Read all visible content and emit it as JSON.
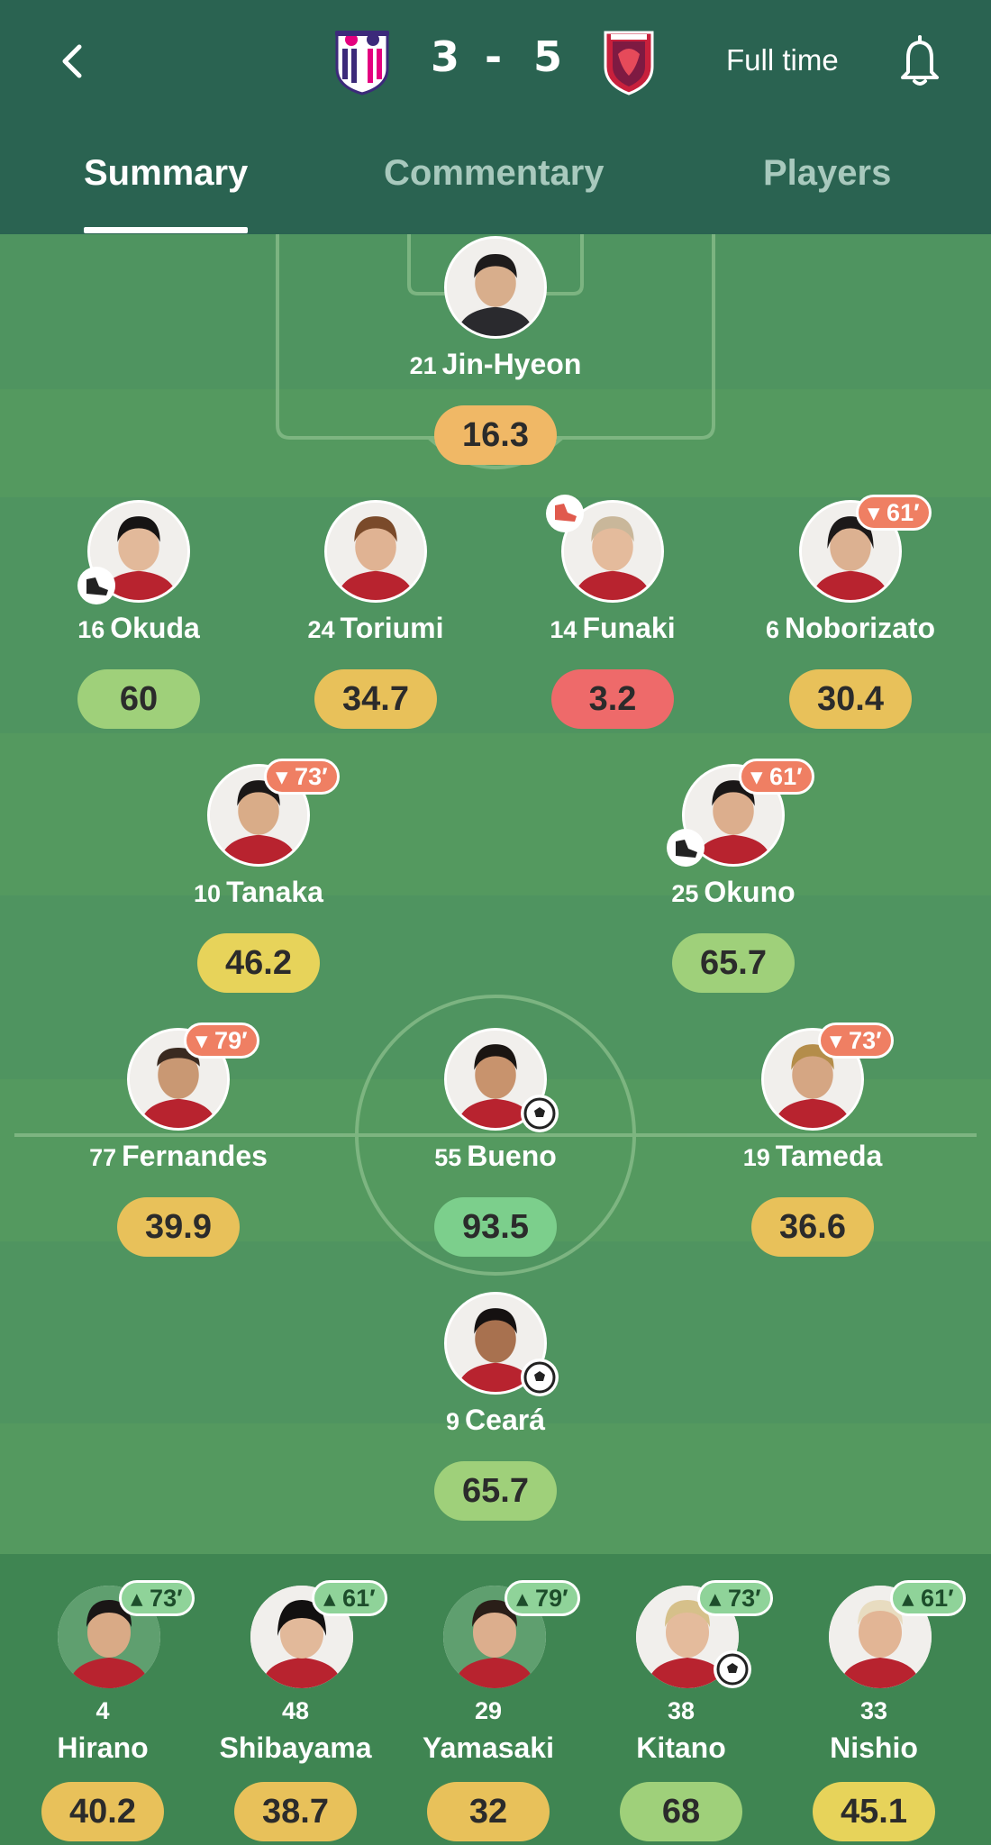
{
  "header": {
    "home_score": "3",
    "separator": "-",
    "away_score": "5",
    "status": "Full time",
    "tabs": [
      "Summary",
      "Commentary",
      "Players"
    ],
    "active_tab": "Summary"
  },
  "colors": {
    "header_bg": "#2a6351",
    "pitch": "#4f9460",
    "rating_green": "#9fd07a",
    "rating_dark_green": "#7ccf8c",
    "rating_yellow": "#e7d35a",
    "rating_amber": "#e8c15a",
    "rating_orange": "#f0b866",
    "rating_red": "#ee6a6a",
    "sub_out": "#ef7f63",
    "sub_in": "#8fd399"
  },
  "starters": [
    {
      "num": "21",
      "name": "Jin-Hyeon",
      "rating": "16.3",
      "rating_color": "#f0b866"
    },
    {
      "num": "16",
      "name": "Okuda",
      "rating": "60",
      "rating_color": "#9fd07a",
      "icon": "boot-icon"
    },
    {
      "num": "24",
      "name": "Toriumi",
      "rating": "34.7",
      "rating_color": "#e8c15a"
    },
    {
      "num": "14",
      "name": "Funaki",
      "rating": "3.2",
      "rating_color": "#ee6a6a",
      "icon": "red-boot-icon"
    },
    {
      "num": "6",
      "name": "Noborizato",
      "rating": "30.4",
      "rating_color": "#e8c15a",
      "sub": "▾ 61′"
    },
    {
      "num": "10",
      "name": "Tanaka",
      "rating": "46.2",
      "rating_color": "#e7d35a",
      "sub": "▾ 73′"
    },
    {
      "num": "25",
      "name": "Okuno",
      "rating": "65.7",
      "rating_color": "#9fd07a",
      "sub": "▾ 61′",
      "icon": "boot-icon"
    },
    {
      "num": "77",
      "name": "Fernandes",
      "rating": "39.9",
      "rating_color": "#e8c15a",
      "sub": "▾ 79′"
    },
    {
      "num": "55",
      "name": "Bueno",
      "rating": "93.5",
      "rating_color": "#7ccf8c",
      "icon": "ball-icon"
    },
    {
      "num": "19",
      "name": "Tameda",
      "rating": "36.6",
      "rating_color": "#e8c15a",
      "sub": "▾ 73′"
    },
    {
      "num": "9",
      "name": "Ceará",
      "rating": "65.7",
      "rating_color": "#9fd07a",
      "icon": "ball-icon"
    }
  ],
  "bench": [
    {
      "num": "4",
      "name": "Hirano",
      "rating": "40.2",
      "rating_color": "#e8c15a",
      "sub": "▴ 73′"
    },
    {
      "num": "48",
      "name": "Shibayama",
      "rating": "38.7",
      "rating_color": "#e8c15a",
      "sub": "▴ 61′"
    },
    {
      "num": "29",
      "name": "Yamasaki",
      "rating": "32",
      "rating_color": "#e8c15a",
      "sub": "▴ 79′"
    },
    {
      "num": "38",
      "name": "Kitano",
      "rating": "68",
      "rating_color": "#9fd07a",
      "sub": "▴ 73′",
      "icon": "ball-icon"
    },
    {
      "num": "33",
      "name": "Nishio",
      "rating": "45.1",
      "rating_color": "#e7d35a",
      "sub": "▴ 61′"
    }
  ]
}
